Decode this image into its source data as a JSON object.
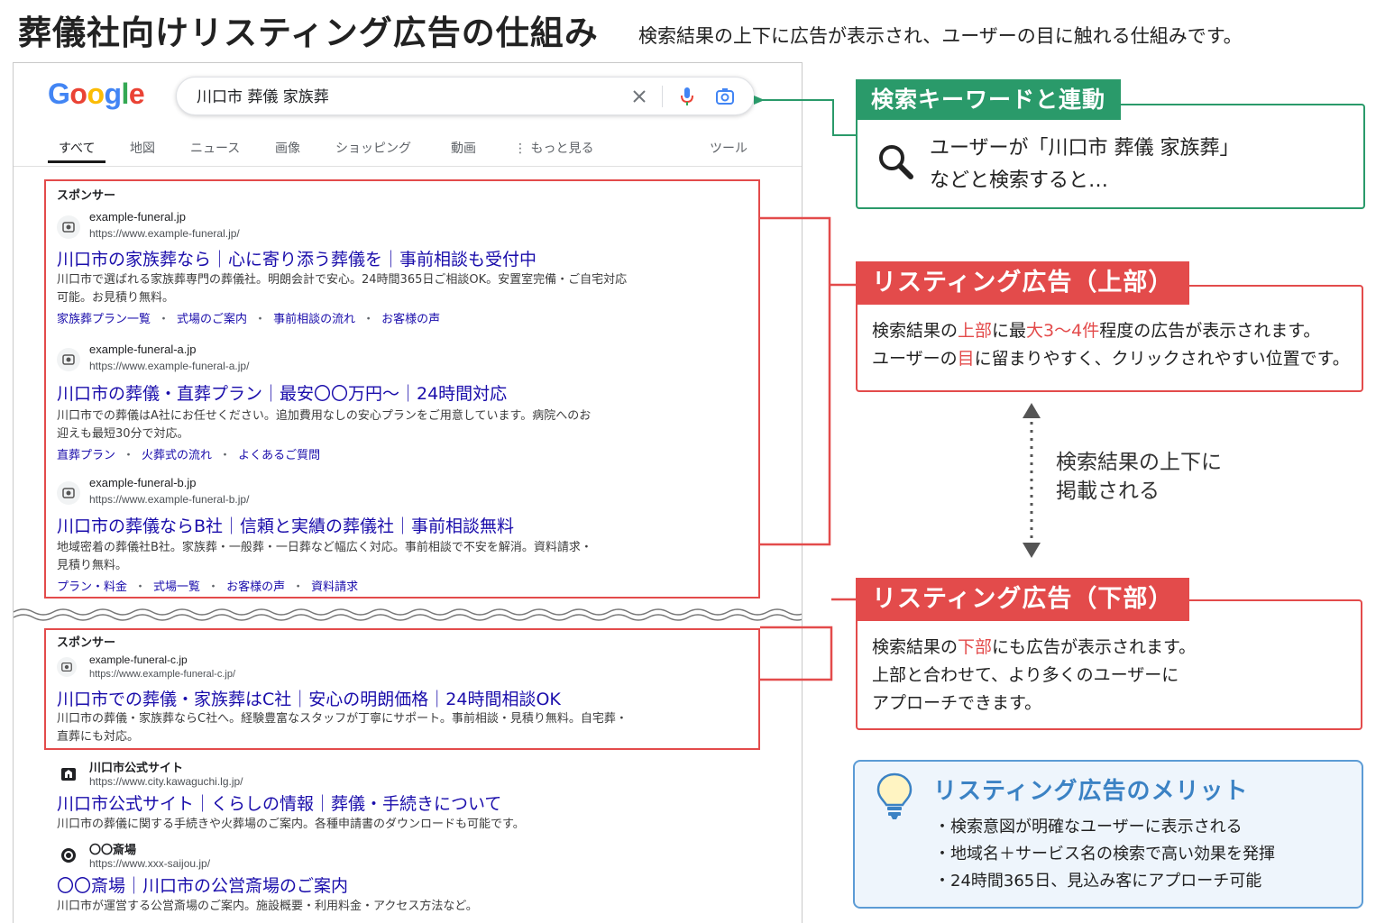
{
  "header": {
    "title": "葬儀社向けリスティング広告の仕組み",
    "subtitle": "検索結果の上下に広告が表示され、ユーザーの目に触れる仕組みです。"
  },
  "serp": {
    "logo": [
      "G",
      "o",
      "o",
      "g",
      "l",
      "e"
    ],
    "search": {
      "query": "川口市 葬儀 家族葬",
      "clear_icon": "close-icon",
      "mic_icon": "mic-icon",
      "lens_icon": "camera-icon"
    },
    "tabs": [
      "すべて",
      "地図",
      "ニュース",
      "画像",
      "ショッピング",
      "動画",
      "⋮ もっと見る",
      "ツール"
    ],
    "active_tab": "すべて",
    "top_sponsor_label": "スポンサー",
    "top_ads": [
      {
        "domain": "example-funeral.jp",
        "url": "https://www.example-funeral.jp/",
        "title": "川口市の家族葬なら｜心に寄り添う葬儀を｜事前相談も受付中",
        "desc": "川口市で選ばれる家族葬専門の葬儀社。明朗会計で安心。24時間365日ご相談OK。安置室完備・ご自宅対応可能。お見積り無料。",
        "sitelinks": [
          "家族葬プラン一覧",
          "式場のご案内",
          "事前相談の流れ",
          "お客様の声"
        ]
      },
      {
        "domain": "example-funeral-a.jp",
        "url": "https://www.example-funeral-a.jp/",
        "title": "川口市の葬儀・直葬プラン｜最安〇〇万円〜｜24時間対応",
        "desc": "川口市での葬儀はA社にお任せください。追加費用なしの安心プランをご用意しています。病院へのお迎えも最短30分で対応。",
        "sitelinks": [
          "直葬プラン",
          "火葬式の流れ",
          "よくあるご質問"
        ]
      },
      {
        "domain": "example-funeral-b.jp",
        "url": "https://www.example-funeral-b.jp/",
        "title": "川口市の葬儀ならB社｜信頼と実績の葬儀社｜事前相談無料",
        "desc": "地域密着の葬儀社B社。家族葬・一般葬・一日葬など幅広く対応。事前相談で不安を解消。資料請求・見積り無料。",
        "sitelinks": [
          "プラン・料金",
          "式場一覧",
          "お客様の声",
          "資料請求"
        ]
      }
    ],
    "bottom_sponsor_label": "スポンサー",
    "bottom_ad": {
      "domain": "example-funeral-c.jp",
      "url": "https://www.example-funeral-c.jp/",
      "title": "川口市での葬儀・家族葬はC社｜安心の明朗価格｜24時間相談OK",
      "desc": "川口市の葬儀・家族葬ならC社へ。経験豊富なスタッフが丁寧にサポート。事前相談・見積り無料。自宅葬・直葬にも対応。"
    },
    "organic": [
      {
        "site": "川口市公式サイト",
        "url": "https://www.city.kawaguchi.lg.jp/",
        "title": "川口市公式サイト｜くらしの情報｜葬儀・手続きについて",
        "desc": "川口市の葬儀に関する手続きや火葬場のご案内。各種申請書のダウンロードも可能です。"
      },
      {
        "site": "〇〇斎場",
        "url": "https://www.xxx-saijou.jp/",
        "title": "〇〇斎場｜川口市の公営斎場のご案内",
        "desc": "川口市が運営する公営斎場のご案内。施設概要・利用料金・アクセス方法など。"
      }
    ]
  },
  "callouts": {
    "keyword": {
      "heading": "検索キーワードと連動",
      "line1": "ユーザーが「川口市 葬儀 家族葬」",
      "line2": "などと検索すると…",
      "icon": "search-icon"
    },
    "top_ad": {
      "heading": "リスティング広告（上部）",
      "l1_a": "検索結果の",
      "l1_b": "上部",
      "l1_c": "に最",
      "l1_d": "大3〜4件",
      "l1_e": "程度の広告が表示されます。",
      "l2_a": "ユーザーの",
      "l2_b": "目",
      "l2_c": "に留まりやすく、クリックされやすい位置です。"
    },
    "between": {
      "line1": "検索結果の上下に",
      "line2": "掲載される"
    },
    "bottom_ad": {
      "heading": "リスティング広告（下部）",
      "l1_a": "検索結果の",
      "l1_b": "下部",
      "l1_c": "にも広告が表示されます。",
      "line2": "上部と合わせて、より多くのユーザーに",
      "line3": "アプローチできます。"
    },
    "merit": {
      "heading": "リスティング広告のメリット",
      "icon": "lightbulb-icon",
      "items": [
        "・検索意図が明確なユーザーに表示される",
        "・地域名＋サービス名の検索で高い効果を発揮",
        "・24時間365日、見込み客にアプローチ可能"
      ]
    }
  },
  "colors": {
    "ad_red": "#e34b4b",
    "keyword_green": "#2a9a6a",
    "merit_blue": "#3b82c4",
    "link_blue": "#1a0dab"
  }
}
